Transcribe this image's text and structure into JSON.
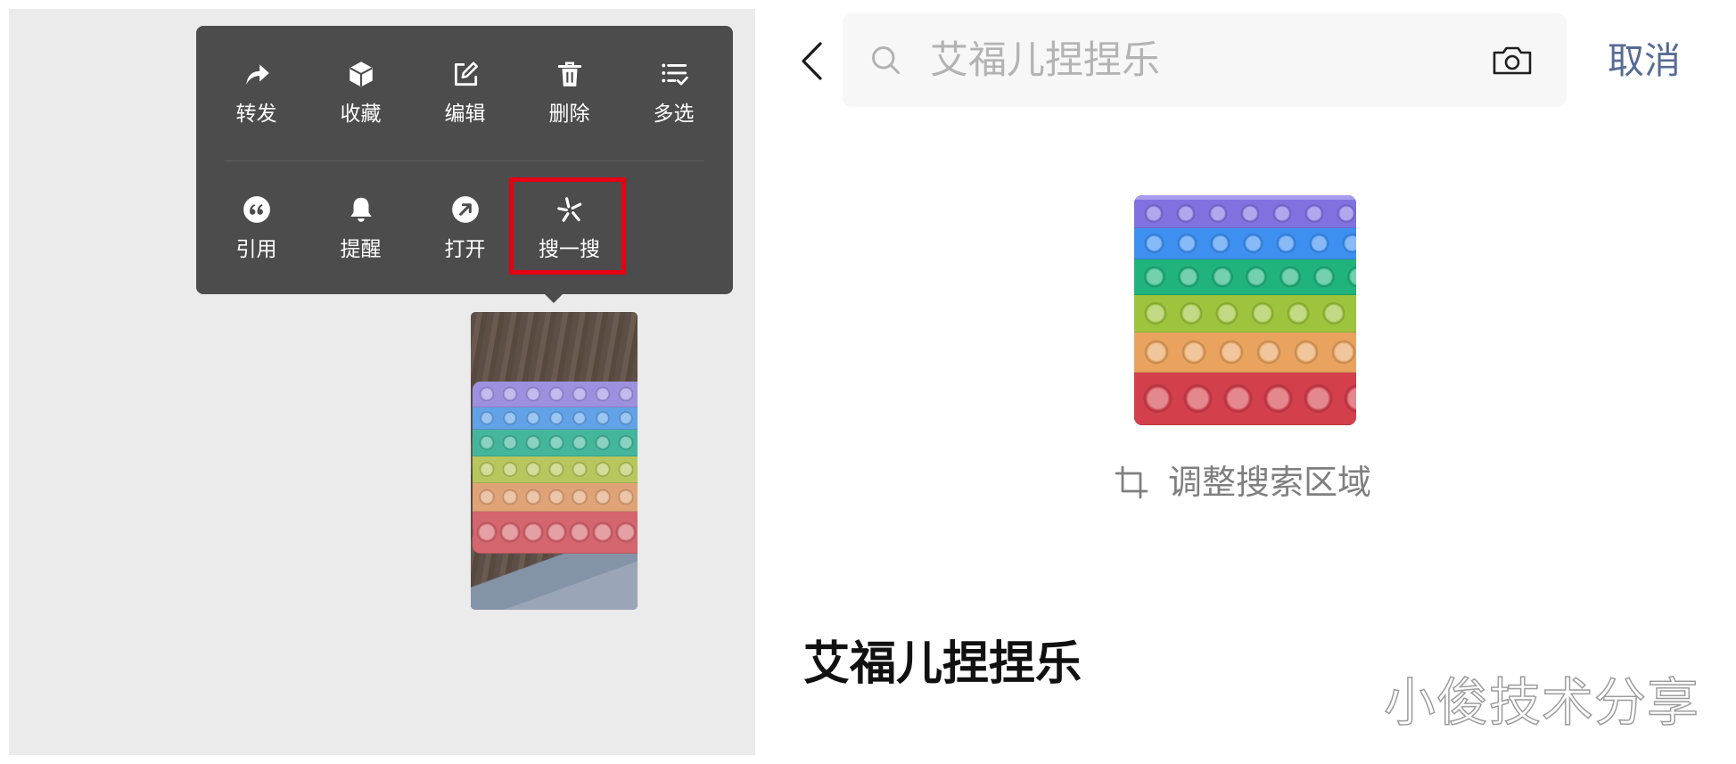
{
  "colors": {
    "chat_background": "#ebebeb",
    "menu_background": "#4c4c4c",
    "highlight_border": "#e60012",
    "link_blue": "#576b95",
    "search_box_background": "#f7f7f7"
  },
  "context_menu": {
    "row1": [
      {
        "label": "转发",
        "icon": "forward-icon"
      },
      {
        "label": "收藏",
        "icon": "favorite-cube-icon"
      },
      {
        "label": "编辑",
        "icon": "edit-icon"
      },
      {
        "label": "删除",
        "icon": "trash-icon"
      },
      {
        "label": "多选",
        "icon": "multi-select-icon"
      }
    ],
    "row2": [
      {
        "label": "引用",
        "icon": "quote-icon"
      },
      {
        "label": "提醒",
        "icon": "bell-icon"
      },
      {
        "label": "打开",
        "icon": "open-arrow-icon"
      },
      {
        "label": "搜一搜",
        "icon": "search-sparkle-icon",
        "highlighted": true
      }
    ]
  },
  "search_page": {
    "back_icon": "back-chevron-icon",
    "search": {
      "icon": "search-icon",
      "placeholder": "艾福儿捏捏乐",
      "camera_icon": "camera-icon"
    },
    "cancel_label": "取消",
    "adjust_area": {
      "icon": "crop-icon",
      "label": "调整搜索区域"
    },
    "result_title": "艾福儿捏捏乐"
  },
  "watermark": "小俊技术分享"
}
